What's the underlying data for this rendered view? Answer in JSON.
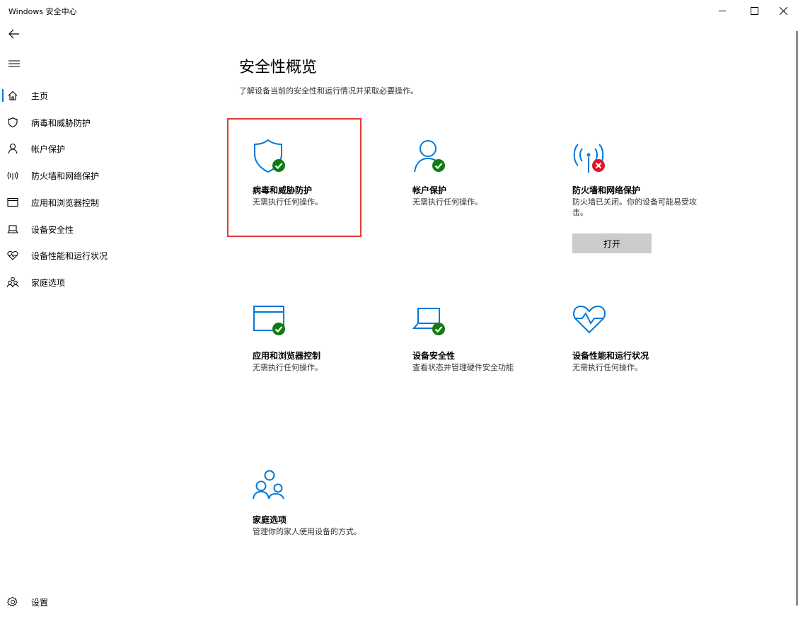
{
  "window": {
    "title": "Windows 安全中心"
  },
  "nav": {
    "items": [
      {
        "label": "主页",
        "icon": "home-icon",
        "active": true
      },
      {
        "label": "病毒和威胁防护",
        "icon": "shield-icon"
      },
      {
        "label": "帐户保护",
        "icon": "person-icon"
      },
      {
        "label": "防火墙和网络保护",
        "icon": "antenna-icon"
      },
      {
        "label": "应用和浏览器控制",
        "icon": "browser-window-icon"
      },
      {
        "label": "设备安全性",
        "icon": "laptop-icon"
      },
      {
        "label": "设备性能和运行状况",
        "icon": "heart-icon"
      },
      {
        "label": "家庭选项",
        "icon": "family-icon"
      }
    ],
    "settings_label": "设置"
  },
  "main": {
    "title": "安全性概览",
    "subtitle": "了解设备当前的安全性和运行情况并采取必要操作。",
    "tiles": [
      {
        "title": "病毒和威胁防护",
        "desc": "无需执行任何操作。",
        "icon": "shield-check-icon",
        "status": "ok"
      },
      {
        "title": "帐户保护",
        "desc": "无需执行任何操作。",
        "icon": "person-check-icon",
        "status": "ok"
      },
      {
        "title": "防火墙和网络保护",
        "desc": "防火墙已关闭。你的设备可能易受攻击。",
        "icon": "antenna-error-icon",
        "status": "error",
        "action": "打开"
      },
      {
        "title": "应用和浏览器控制",
        "desc": "无需执行任何操作。",
        "icon": "browser-check-icon",
        "status": "ok"
      },
      {
        "title": "设备安全性",
        "desc": "查看状态并管理硬件安全功能",
        "icon": "laptop-check-icon",
        "status": "ok"
      },
      {
        "title": "设备性能和运行状况",
        "desc": "无需执行任何操作。",
        "icon": "heart-pulse-icon",
        "status": "ok"
      },
      {
        "title": "家庭选项",
        "desc": "管理你的家人使用设备的方式。",
        "icon": "family-icon"
      }
    ]
  },
  "colors": {
    "accent": "#0078d7",
    "ok": "#107c10",
    "error": "#e81123",
    "highlight": "#e03c31"
  }
}
